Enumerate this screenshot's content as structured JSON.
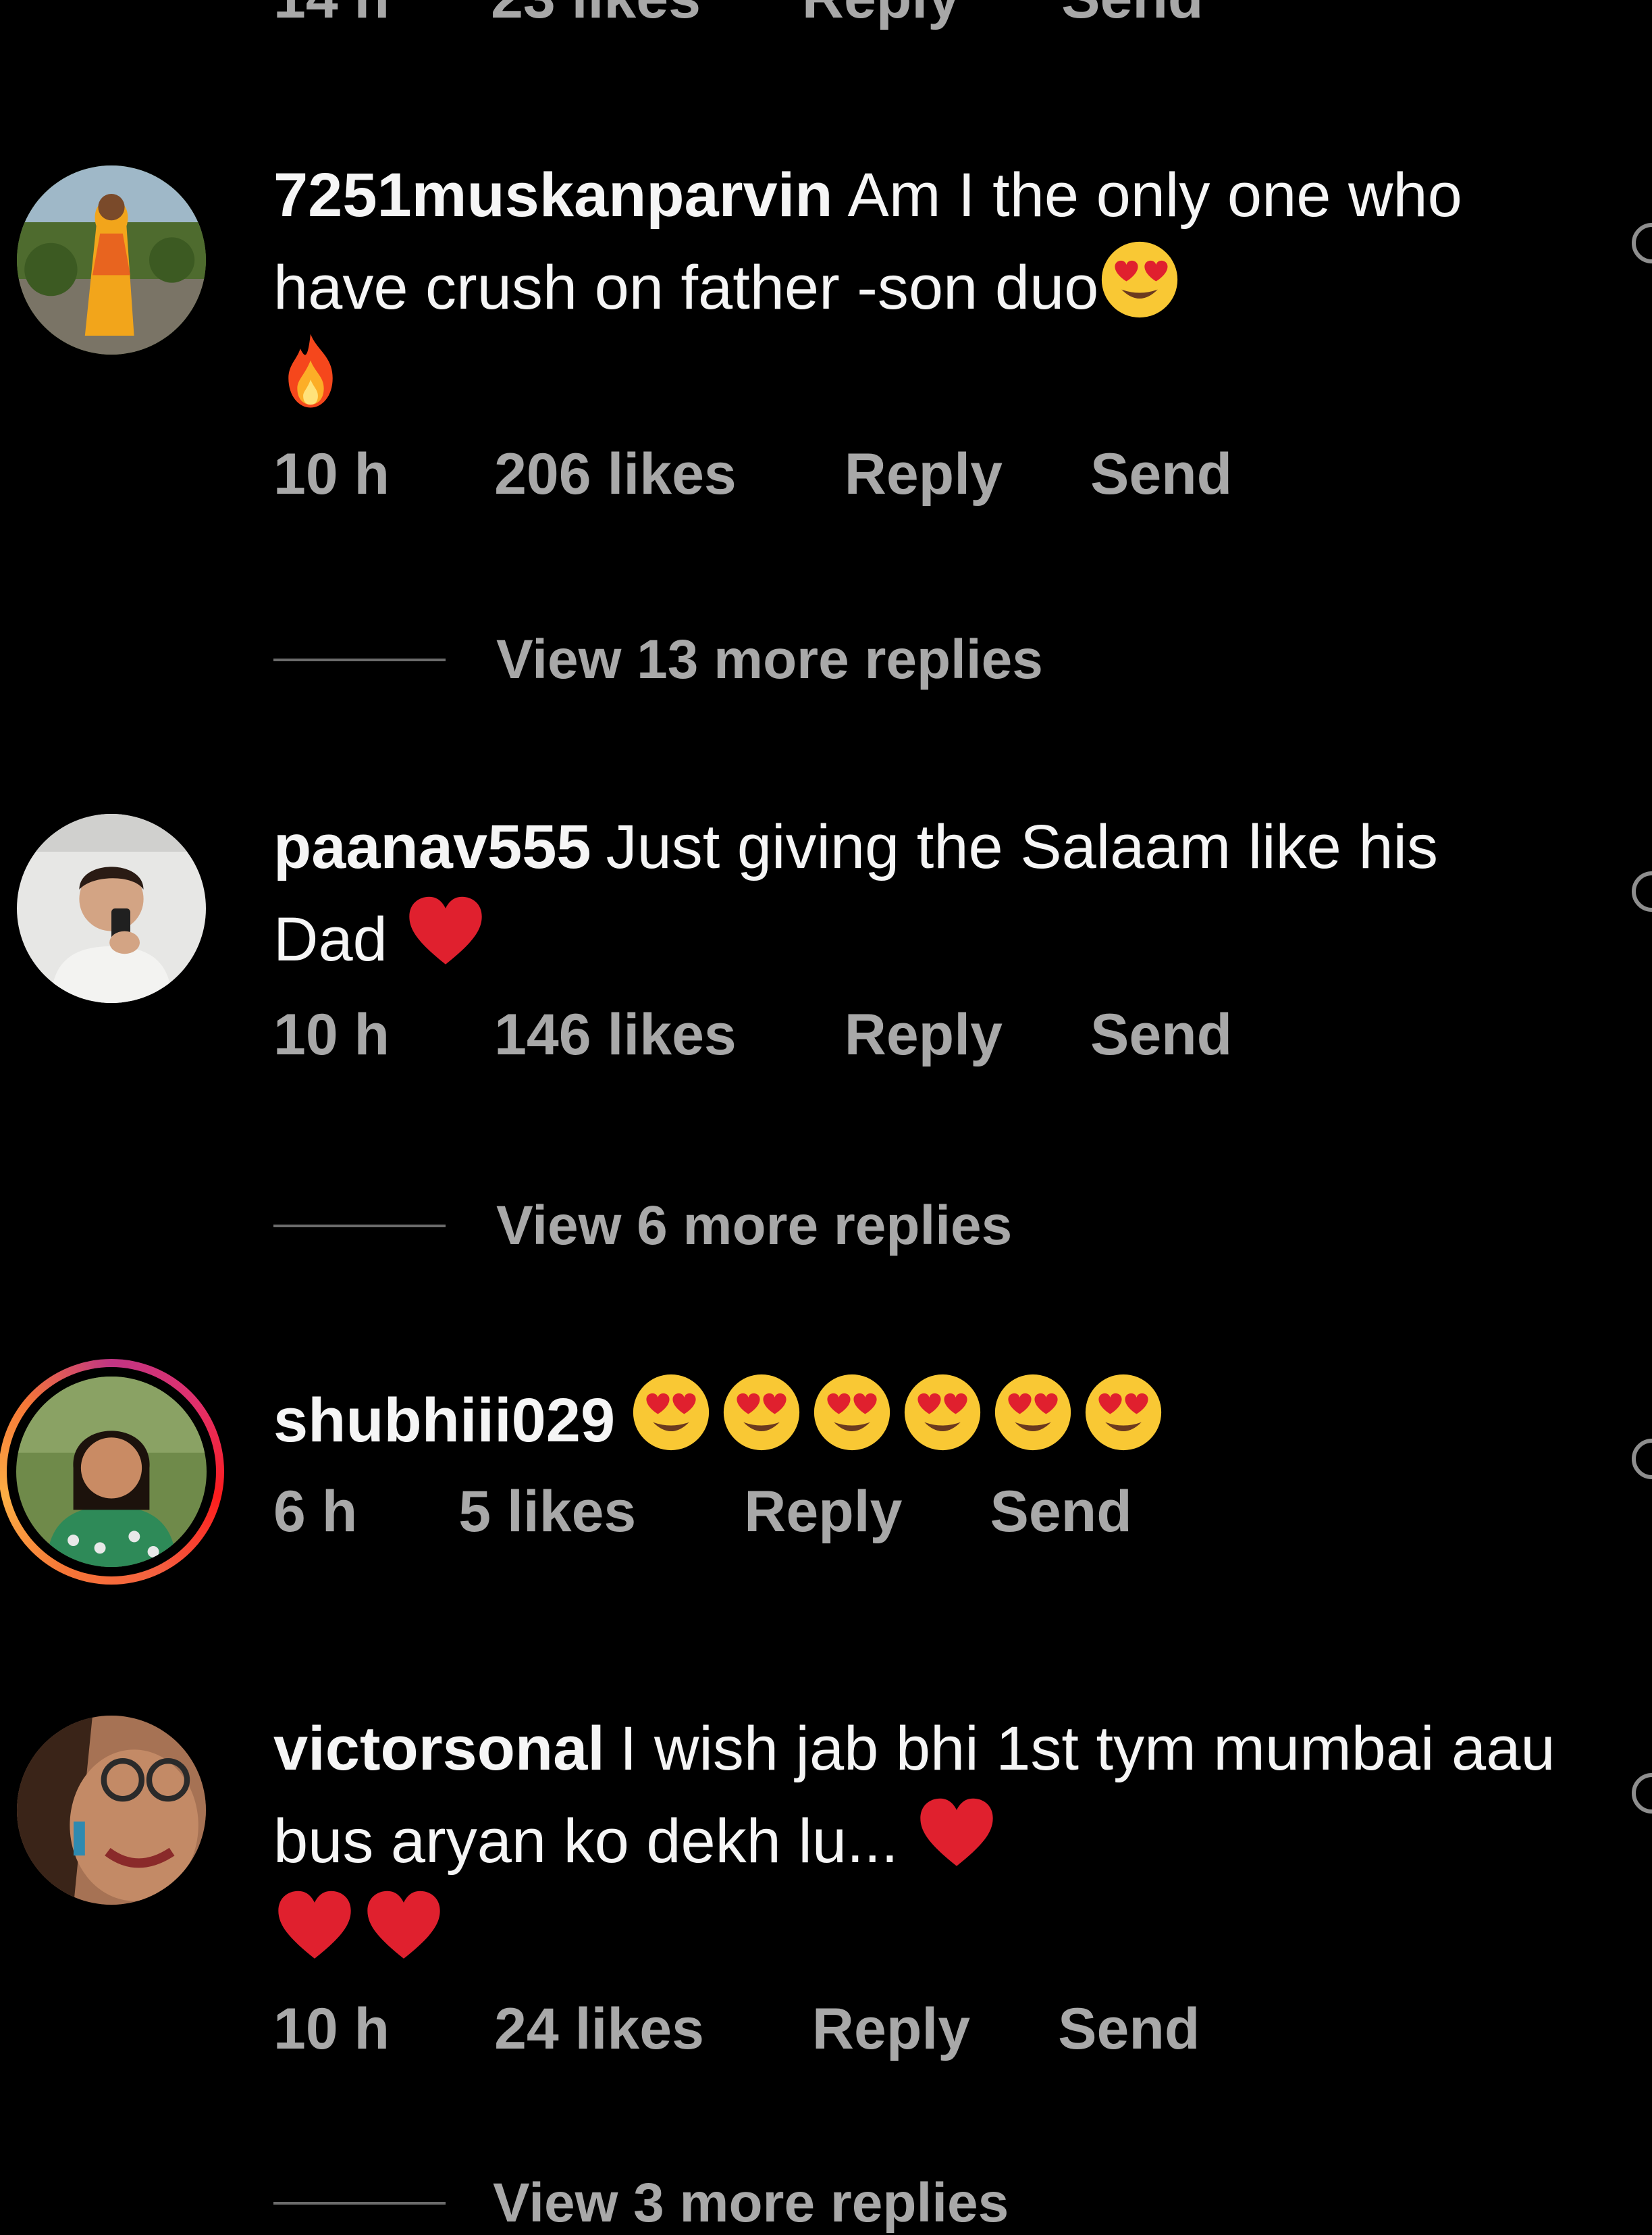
{
  "top_cutoff": {
    "time": "14 h",
    "likes": "23 likes",
    "reply": "Reply",
    "send": "Send"
  },
  "comments": [
    {
      "username": "7251muskanparvin",
      "text": "Am I the only one who have crush on father -son duo",
      "emojis": [
        "heart-eyes-emoji",
        "fire-emoji"
      ],
      "time": "10 h",
      "likes": "206 likes",
      "reply": "Reply",
      "send": "Send",
      "view_replies": "View 13 more replies",
      "story_ring": false
    },
    {
      "username": "paanav555",
      "text": "Just giving the Salaam like his Dad",
      "emojis": [
        "red-heart-emoji"
      ],
      "time": "10 h",
      "likes": "146 likes",
      "reply": "Reply",
      "send": "Send",
      "view_replies": "View 6 more replies",
      "story_ring": false
    },
    {
      "username": "shubhiii029",
      "text": "",
      "emojis": [
        "heart-eyes-emoji",
        "heart-eyes-emoji",
        "heart-eyes-emoji",
        "heart-eyes-emoji",
        "heart-eyes-emoji",
        "heart-eyes-emoji"
      ],
      "time": "6 h",
      "likes": "5 likes",
      "reply": "Reply",
      "send": "Send",
      "view_replies": "",
      "story_ring": true
    },
    {
      "username": "victorsonal",
      "text": "I wish jab bhi 1st tym mumbai aau bus aryan ko dekh lu...",
      "emojis": [
        "red-heart-emoji",
        "red-heart-emoji",
        "red-heart-emoji"
      ],
      "time": "10 h",
      "likes": "24 likes",
      "reply": "Reply",
      "send": "Send",
      "view_replies": "View 3 more replies",
      "story_ring": false
    }
  ],
  "colors": {
    "background": "#000000",
    "primary_text": "#f5f5f5",
    "secondary_text": "#a8a8a8",
    "divider": "#6b6b6b",
    "heart": "#e0202e",
    "story_ring": "#e1306c"
  }
}
